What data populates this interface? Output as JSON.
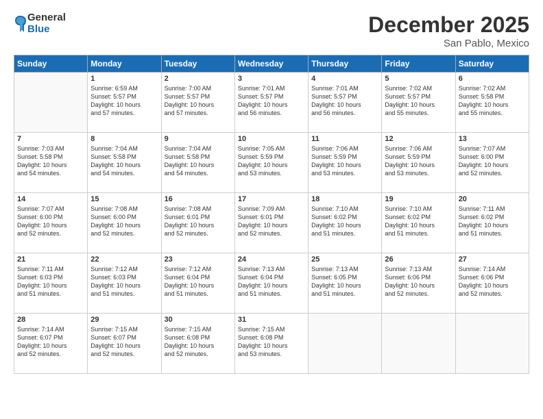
{
  "header": {
    "logo_general": "General",
    "logo_blue": "Blue",
    "month_title": "December 2025",
    "location": "San Pablo, Mexico"
  },
  "weekdays": [
    "Sunday",
    "Monday",
    "Tuesday",
    "Wednesday",
    "Thursday",
    "Friday",
    "Saturday"
  ],
  "weeks": [
    [
      {
        "day": "",
        "info": ""
      },
      {
        "day": "1",
        "info": "Sunrise: 6:59 AM\nSunset: 5:57 PM\nDaylight: 10 hours\nand 57 minutes."
      },
      {
        "day": "2",
        "info": "Sunrise: 7:00 AM\nSunset: 5:57 PM\nDaylight: 10 hours\nand 57 minutes."
      },
      {
        "day": "3",
        "info": "Sunrise: 7:01 AM\nSunset: 5:57 PM\nDaylight: 10 hours\nand 56 minutes."
      },
      {
        "day": "4",
        "info": "Sunrise: 7:01 AM\nSunset: 5:57 PM\nDaylight: 10 hours\nand 56 minutes."
      },
      {
        "day": "5",
        "info": "Sunrise: 7:02 AM\nSunset: 5:57 PM\nDaylight: 10 hours\nand 55 minutes."
      },
      {
        "day": "6",
        "info": "Sunrise: 7:02 AM\nSunset: 5:58 PM\nDaylight: 10 hours\nand 55 minutes."
      }
    ],
    [
      {
        "day": "7",
        "info": "Sunrise: 7:03 AM\nSunset: 5:58 PM\nDaylight: 10 hours\nand 54 minutes."
      },
      {
        "day": "8",
        "info": "Sunrise: 7:04 AM\nSunset: 5:58 PM\nDaylight: 10 hours\nand 54 minutes."
      },
      {
        "day": "9",
        "info": "Sunrise: 7:04 AM\nSunset: 5:58 PM\nDaylight: 10 hours\nand 54 minutes."
      },
      {
        "day": "10",
        "info": "Sunrise: 7:05 AM\nSunset: 5:59 PM\nDaylight: 10 hours\nand 53 minutes."
      },
      {
        "day": "11",
        "info": "Sunrise: 7:06 AM\nSunset: 5:59 PM\nDaylight: 10 hours\nand 53 minutes."
      },
      {
        "day": "12",
        "info": "Sunrise: 7:06 AM\nSunset: 5:59 PM\nDaylight: 10 hours\nand 53 minutes."
      },
      {
        "day": "13",
        "info": "Sunrise: 7:07 AM\nSunset: 6:00 PM\nDaylight: 10 hours\nand 52 minutes."
      }
    ],
    [
      {
        "day": "14",
        "info": "Sunrise: 7:07 AM\nSunset: 6:00 PM\nDaylight: 10 hours\nand 52 minutes."
      },
      {
        "day": "15",
        "info": "Sunrise: 7:08 AM\nSunset: 6:00 PM\nDaylight: 10 hours\nand 52 minutes."
      },
      {
        "day": "16",
        "info": "Sunrise: 7:08 AM\nSunset: 6:01 PM\nDaylight: 10 hours\nand 52 minutes."
      },
      {
        "day": "17",
        "info": "Sunrise: 7:09 AM\nSunset: 6:01 PM\nDaylight: 10 hours\nand 52 minutes."
      },
      {
        "day": "18",
        "info": "Sunrise: 7:10 AM\nSunset: 6:02 PM\nDaylight: 10 hours\nand 51 minutes."
      },
      {
        "day": "19",
        "info": "Sunrise: 7:10 AM\nSunset: 6:02 PM\nDaylight: 10 hours\nand 51 minutes."
      },
      {
        "day": "20",
        "info": "Sunrise: 7:11 AM\nSunset: 6:02 PM\nDaylight: 10 hours\nand 51 minutes."
      }
    ],
    [
      {
        "day": "21",
        "info": "Sunrise: 7:11 AM\nSunset: 6:03 PM\nDaylight: 10 hours\nand 51 minutes."
      },
      {
        "day": "22",
        "info": "Sunrise: 7:12 AM\nSunset: 6:03 PM\nDaylight: 10 hours\nand 51 minutes."
      },
      {
        "day": "23",
        "info": "Sunrise: 7:12 AM\nSunset: 6:04 PM\nDaylight: 10 hours\nand 51 minutes."
      },
      {
        "day": "24",
        "info": "Sunrise: 7:13 AM\nSunset: 6:04 PM\nDaylight: 10 hours\nand 51 minutes."
      },
      {
        "day": "25",
        "info": "Sunrise: 7:13 AM\nSunset: 6:05 PM\nDaylight: 10 hours\nand 51 minutes."
      },
      {
        "day": "26",
        "info": "Sunrise: 7:13 AM\nSunset: 6:06 PM\nDaylight: 10 hours\nand 52 minutes."
      },
      {
        "day": "27",
        "info": "Sunrise: 7:14 AM\nSunset: 6:06 PM\nDaylight: 10 hours\nand 52 minutes."
      }
    ],
    [
      {
        "day": "28",
        "info": "Sunrise: 7:14 AM\nSunset: 6:07 PM\nDaylight: 10 hours\nand 52 minutes."
      },
      {
        "day": "29",
        "info": "Sunrise: 7:15 AM\nSunset: 6:07 PM\nDaylight: 10 hours\nand 52 minutes."
      },
      {
        "day": "30",
        "info": "Sunrise: 7:15 AM\nSunset: 6:08 PM\nDaylight: 10 hours\nand 52 minutes."
      },
      {
        "day": "31",
        "info": "Sunrise: 7:15 AM\nSunset: 6:08 PM\nDaylight: 10 hours\nand 53 minutes."
      },
      {
        "day": "",
        "info": ""
      },
      {
        "day": "",
        "info": ""
      },
      {
        "day": "",
        "info": ""
      }
    ]
  ]
}
